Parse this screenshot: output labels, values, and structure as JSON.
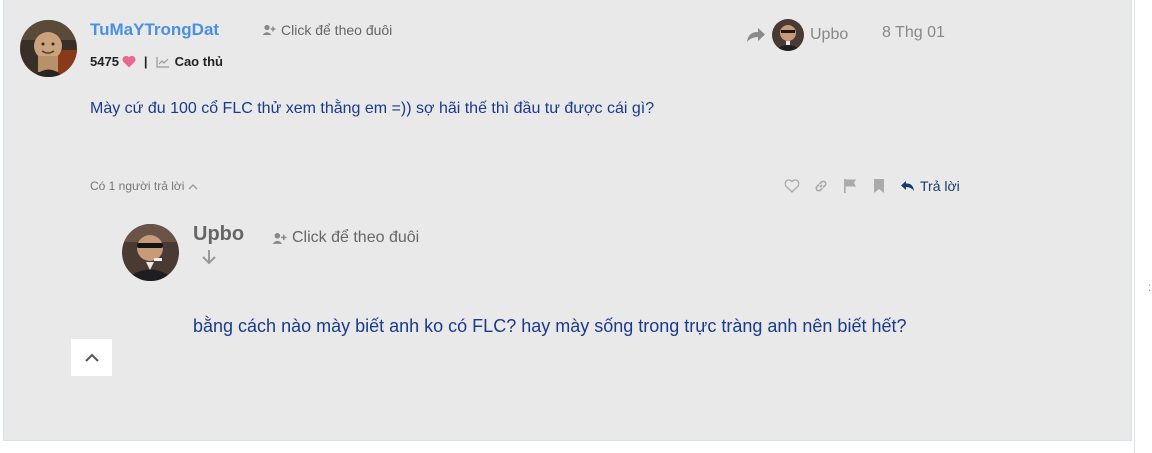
{
  "post": {
    "author": "TuMaYTrongDat",
    "follow_label": "Click để theo đuôi",
    "points": "5475",
    "rank": "Cao thủ",
    "reply_to_user": "Upbo",
    "date": "8 Thg 01",
    "body": "Mày cứ đu 100 cổ FLC thử xem thằng em =)) sợ hãi thế thì đầu tư được cái gì?",
    "reply_count_label": "Có 1 người trả lời",
    "reply_button_label": "Trả lời"
  },
  "reply": {
    "author": "Upbo",
    "follow_label": "Click để theo đuôi",
    "body": "bằng cách nào mày biết anh ko có FLC? hay mày sống trong trực tràng anh nên biết hết?"
  },
  "colors": {
    "background": "#e9e9e9",
    "username": "#4a90e2",
    "body_text": "#1a3a8a",
    "heart": "#e86a8a"
  },
  "icons": [
    "add-user-icon",
    "heart-icon",
    "chart-line-icon",
    "share-arrow-icon",
    "chevron-up-icon",
    "link-icon",
    "flag-icon",
    "bookmark-icon",
    "reply-icon",
    "arrow-down-icon"
  ]
}
